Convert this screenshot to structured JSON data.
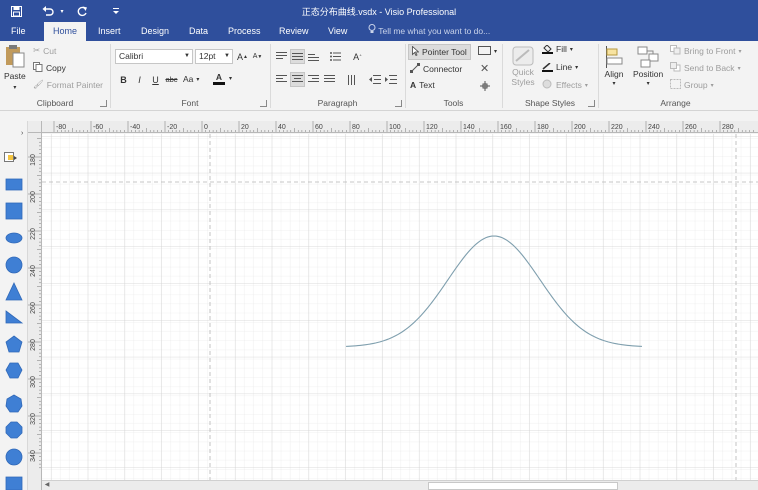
{
  "window": {
    "title": "正态分布曲线.vsdx - Visio Professional",
    "quick_access": [
      "save-icon",
      "undo-icon",
      "redo-icon",
      "customize-icon"
    ]
  },
  "tabs": [
    {
      "label": "File",
      "active": false
    },
    {
      "label": "Home",
      "active": true
    },
    {
      "label": "Insert",
      "active": false
    },
    {
      "label": "Design",
      "active": false
    },
    {
      "label": "Data",
      "active": false
    },
    {
      "label": "Process",
      "active": false
    },
    {
      "label": "Review",
      "active": false
    },
    {
      "label": "View",
      "active": false
    }
  ],
  "tell_me": "Tell me what you want to do...",
  "ribbon": {
    "clipboard": {
      "label": "Clipboard",
      "paste": "Paste",
      "cut": "Cut",
      "copy": "Copy",
      "format_painter": "Format Painter"
    },
    "font": {
      "label": "Font",
      "font_name": "Calibri",
      "font_size": "12pt",
      "bold": "B",
      "italic": "I",
      "underline": "U",
      "strike": "abc",
      "case": "Aa",
      "color_letter": "A"
    },
    "paragraph": {
      "label": "Paragraph"
    },
    "tools": {
      "label": "Tools",
      "pointer_tool": "Pointer Tool",
      "connector": "Connector",
      "text": "Text"
    },
    "shape_styles": {
      "label": "Shape Styles",
      "quick_styles": "Quick Styles",
      "fill": "Fill",
      "line": "Line",
      "effects": "Effects"
    },
    "arrange": {
      "label": "Arrange",
      "align": "Align",
      "position": "Position",
      "bring_to_front": "Bring to Front",
      "send_to_back": "Send to Back",
      "group": "Group"
    }
  },
  "ruler_h": [
    "-80",
    "-60",
    "-40",
    "-20",
    "0",
    "20",
    "40",
    "60",
    "80",
    "100",
    "120",
    "140",
    "160",
    "180",
    "200",
    "220",
    "240",
    "260",
    "280"
  ],
  "ruler_v": [
    "180",
    "200",
    "220",
    "240",
    "260",
    "280",
    "300",
    "320",
    "340"
  ],
  "shapes_panel": [
    "rectangle",
    "square",
    "ellipse",
    "circle",
    "triangle",
    "right-triangle",
    "pentagon",
    "hexagon",
    "heptagon",
    "octagon",
    "decagon",
    "can"
  ],
  "drawing": {
    "shape": "normal distribution curve",
    "stroke_color": "#7f9fae"
  }
}
